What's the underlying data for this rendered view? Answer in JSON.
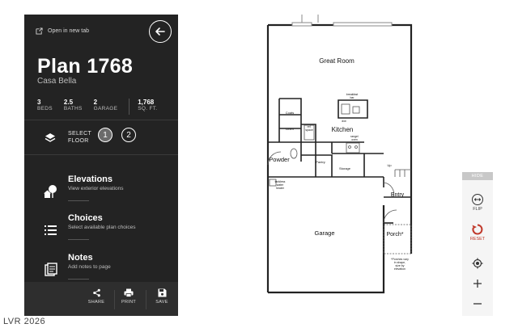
{
  "panel": {
    "open_tab": "Open in new tab",
    "title": "Plan 1768",
    "subtitle": "Casa Bella",
    "stats": [
      {
        "value": "3",
        "label": "BEDS"
      },
      {
        "value": "2.5",
        "label": "BATHS"
      },
      {
        "value": "2",
        "label": "GARAGE"
      },
      {
        "value": "1,768",
        "label": "SQ. FT."
      }
    ],
    "select_floor": [
      "SELECT",
      "FLOOR"
    ],
    "floors": [
      "1",
      "2"
    ],
    "menu": [
      {
        "title": "Elevations",
        "desc": "View exterior elevations",
        "icon": "house-tree-icon"
      },
      {
        "title": "Choices",
        "desc": "Select available plan choices",
        "icon": "list-icon"
      },
      {
        "title": "Notes",
        "desc": "Add notes to page",
        "icon": "notes-icon"
      }
    ],
    "bottom": [
      "SHARE",
      "PRINT",
      "SAVE"
    ]
  },
  "floorplan": {
    "rooms": {
      "great_room": "Great Room",
      "kitchen": "Kitchen",
      "breakfast_bar": [
        "breakfast",
        "bar"
      ],
      "coats": "Coats",
      "linen": "Linen",
      "ref_space": [
        "ref.",
        "space"
      ],
      "dw": "d/w",
      "range_oven": [
        "range/",
        "oven"
      ],
      "powder": "Powder",
      "pantry": "Pantry",
      "storage": "Storage",
      "up": "Up",
      "tankless": [
        "tankless",
        "water",
        "heater"
      ],
      "entry": "Entry",
      "garage": "Garage",
      "porch": "Porch*",
      "porch_note": [
        "*Porches vary",
        "in shape,",
        "size by",
        "elevation"
      ]
    }
  },
  "tools": {
    "hide": "HIDE",
    "flip": "FLIP",
    "reset": "RESET",
    "reset_color": "#c0392b"
  },
  "watermark": "LVR 2026"
}
